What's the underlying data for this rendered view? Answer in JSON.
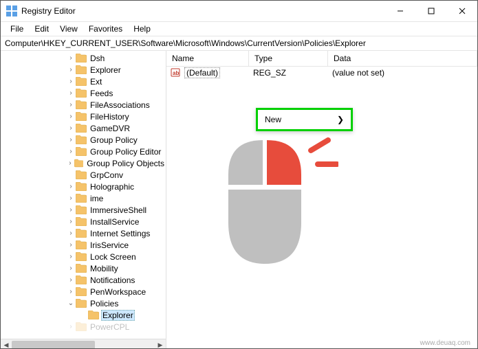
{
  "title": "Registry Editor",
  "menu": [
    "File",
    "Edit",
    "View",
    "Favorites",
    "Help"
  ],
  "address": "Computer\\HKEY_CURRENT_USER\\Software\\Microsoft\\Windows\\CurrentVersion\\Policies\\Explorer",
  "columns": {
    "name": "Name",
    "type": "Type",
    "data": "Data"
  },
  "row": {
    "name": "(Default)",
    "type": "REG_SZ",
    "data": "(value not set)"
  },
  "ctx": {
    "label": "New",
    "arrow": "❯"
  },
  "tree": {
    "indent": 95,
    "items": [
      {
        "label": "Dsh",
        "chev": ">"
      },
      {
        "label": "Explorer",
        "chev": ">"
      },
      {
        "label": "Ext",
        "chev": ">"
      },
      {
        "label": "Feeds",
        "chev": ">"
      },
      {
        "label": "FileAssociations",
        "chev": ">"
      },
      {
        "label": "FileHistory",
        "chev": ">"
      },
      {
        "label": "GameDVR",
        "chev": ">"
      },
      {
        "label": "Group Policy",
        "chev": ">"
      },
      {
        "label": "Group Policy Editor",
        "chev": ">"
      },
      {
        "label": "Group Policy Objects",
        "chev": ">"
      },
      {
        "label": "GrpConv",
        "chev": ""
      },
      {
        "label": "Holographic",
        "chev": ">"
      },
      {
        "label": "ime",
        "chev": ">"
      },
      {
        "label": "ImmersiveShell",
        "chev": ">"
      },
      {
        "label": "InstallService",
        "chev": ">"
      },
      {
        "label": "Internet Settings",
        "chev": ">"
      },
      {
        "label": "IrisService",
        "chev": ">"
      },
      {
        "label": "Lock Screen",
        "chev": ">"
      },
      {
        "label": "Mobility",
        "chev": ">"
      },
      {
        "label": "Notifications",
        "chev": ">"
      },
      {
        "label": "PenWorkspace",
        "chev": ">"
      },
      {
        "label": "Policies",
        "chev": "v",
        "expanded": true,
        "children": [
          {
            "label": "Explorer",
            "selected": true
          }
        ]
      },
      {
        "label": "PowerCPL",
        "chev": ">",
        "faded": true
      }
    ]
  },
  "watermark": "www.deuaq.com"
}
